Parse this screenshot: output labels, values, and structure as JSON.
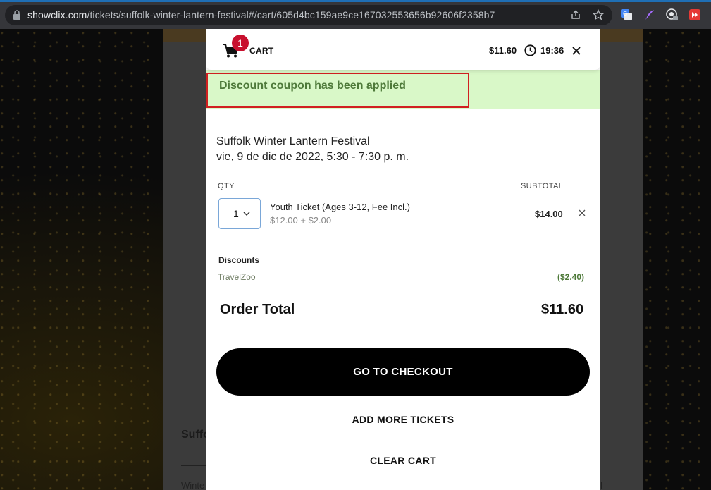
{
  "browser": {
    "url_domain": "showclix.com",
    "url_path": "/tickets/suffolk-winter-lantern-festival#/cart/605d4bc159ae9ce167032553656b92606f2358b7",
    "icons": [
      "lock-icon",
      "share-icon",
      "star-icon",
      "translate-icon",
      "feather-icon",
      "profile-icon",
      "video-speed-icon"
    ]
  },
  "background_page": {
    "title_fragment": "Suffo",
    "text_fragment": "Winte",
    "text_fragment_right": "l"
  },
  "cart": {
    "label": "CART",
    "badge_count": "1",
    "header_total": "$11.60",
    "timer": "19:36",
    "coupon_message": "Discount coupon has been applied",
    "event": {
      "name": "Suffolk Winter Lantern Festival",
      "date": "vie, 9 de dic de 2022, 5:30 - 7:30 p. m."
    },
    "columns": {
      "qty": "QTY",
      "subtotal": "SUBTOTAL"
    },
    "ticket": {
      "qty": "1",
      "name": "Youth Ticket (Ages 3-12, Fee Incl.)",
      "price": "$12.00  + $2.00",
      "subtotal": "$14.00"
    },
    "discounts": {
      "label": "Discounts",
      "name": "TravelZoo",
      "amount": "($2.40)"
    },
    "order_total_label": "Order Total",
    "order_total": "$11.60",
    "checkout_label": "GO TO CHECKOUT",
    "add_more_label": "ADD MORE TICKETS",
    "clear_label": "CLEAR CART"
  },
  "colors": {
    "badge": "#c8102e",
    "coupon_bg": "#d9f8c8",
    "coupon_text": "#4e7a3a",
    "highlight_border": "#d12020",
    "checkout_bg": "#000000"
  }
}
